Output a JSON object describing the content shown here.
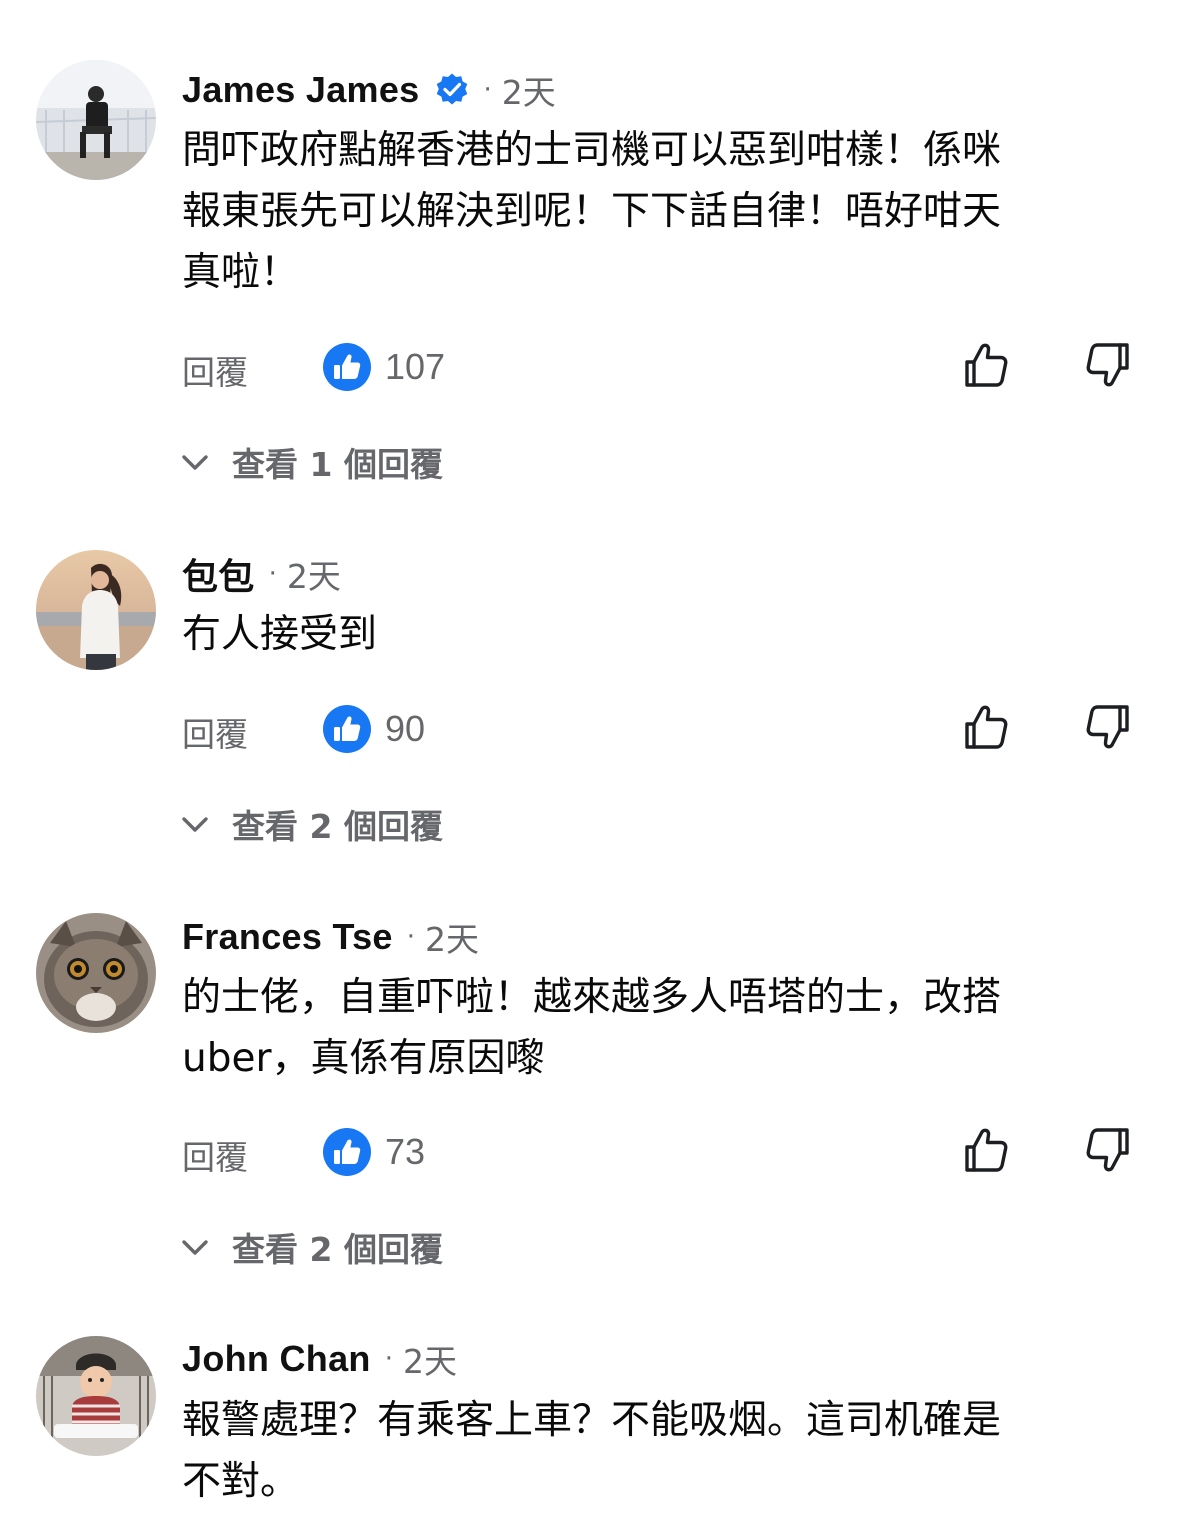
{
  "colors": {
    "accent_blue": "#1877f2",
    "secondary_text": "#65676b",
    "icon_stroke": "#1c1e21"
  },
  "comments": [
    {
      "name": "James James",
      "verified": true,
      "time": "2天",
      "text": "問吓政府點解香港的士司機可以惡到咁樣！係咪\n報東張先可以解決到呢！下下話自律！唔好咁天\n真啦！",
      "reply_label": "回覆",
      "likes": "107",
      "view_replies": "查看 1 個回覆",
      "avatar_icon": "avatar-photo"
    },
    {
      "name": "包包",
      "verified": false,
      "time": "2天",
      "text": "冇人接受到",
      "reply_label": "回覆",
      "likes": "90",
      "view_replies": "查看 2 個回覆",
      "avatar_icon": "avatar-photo"
    },
    {
      "name": "Frances Tse",
      "verified": false,
      "time": "2天",
      "text": "的士佬，自重吓啦！越來越多人唔塔的士，改搭\nuber，真係有原因嚟",
      "reply_label": "回覆",
      "likes": "73",
      "view_replies": "查看 2 個回覆",
      "avatar_icon": "avatar-photo"
    },
    {
      "name": "John Chan",
      "verified": false,
      "time": "2天",
      "text": "報警處理？有乘客上車？不能吸烟。這司机確是\n不對。",
      "avatar_icon": "avatar-photo"
    }
  ]
}
